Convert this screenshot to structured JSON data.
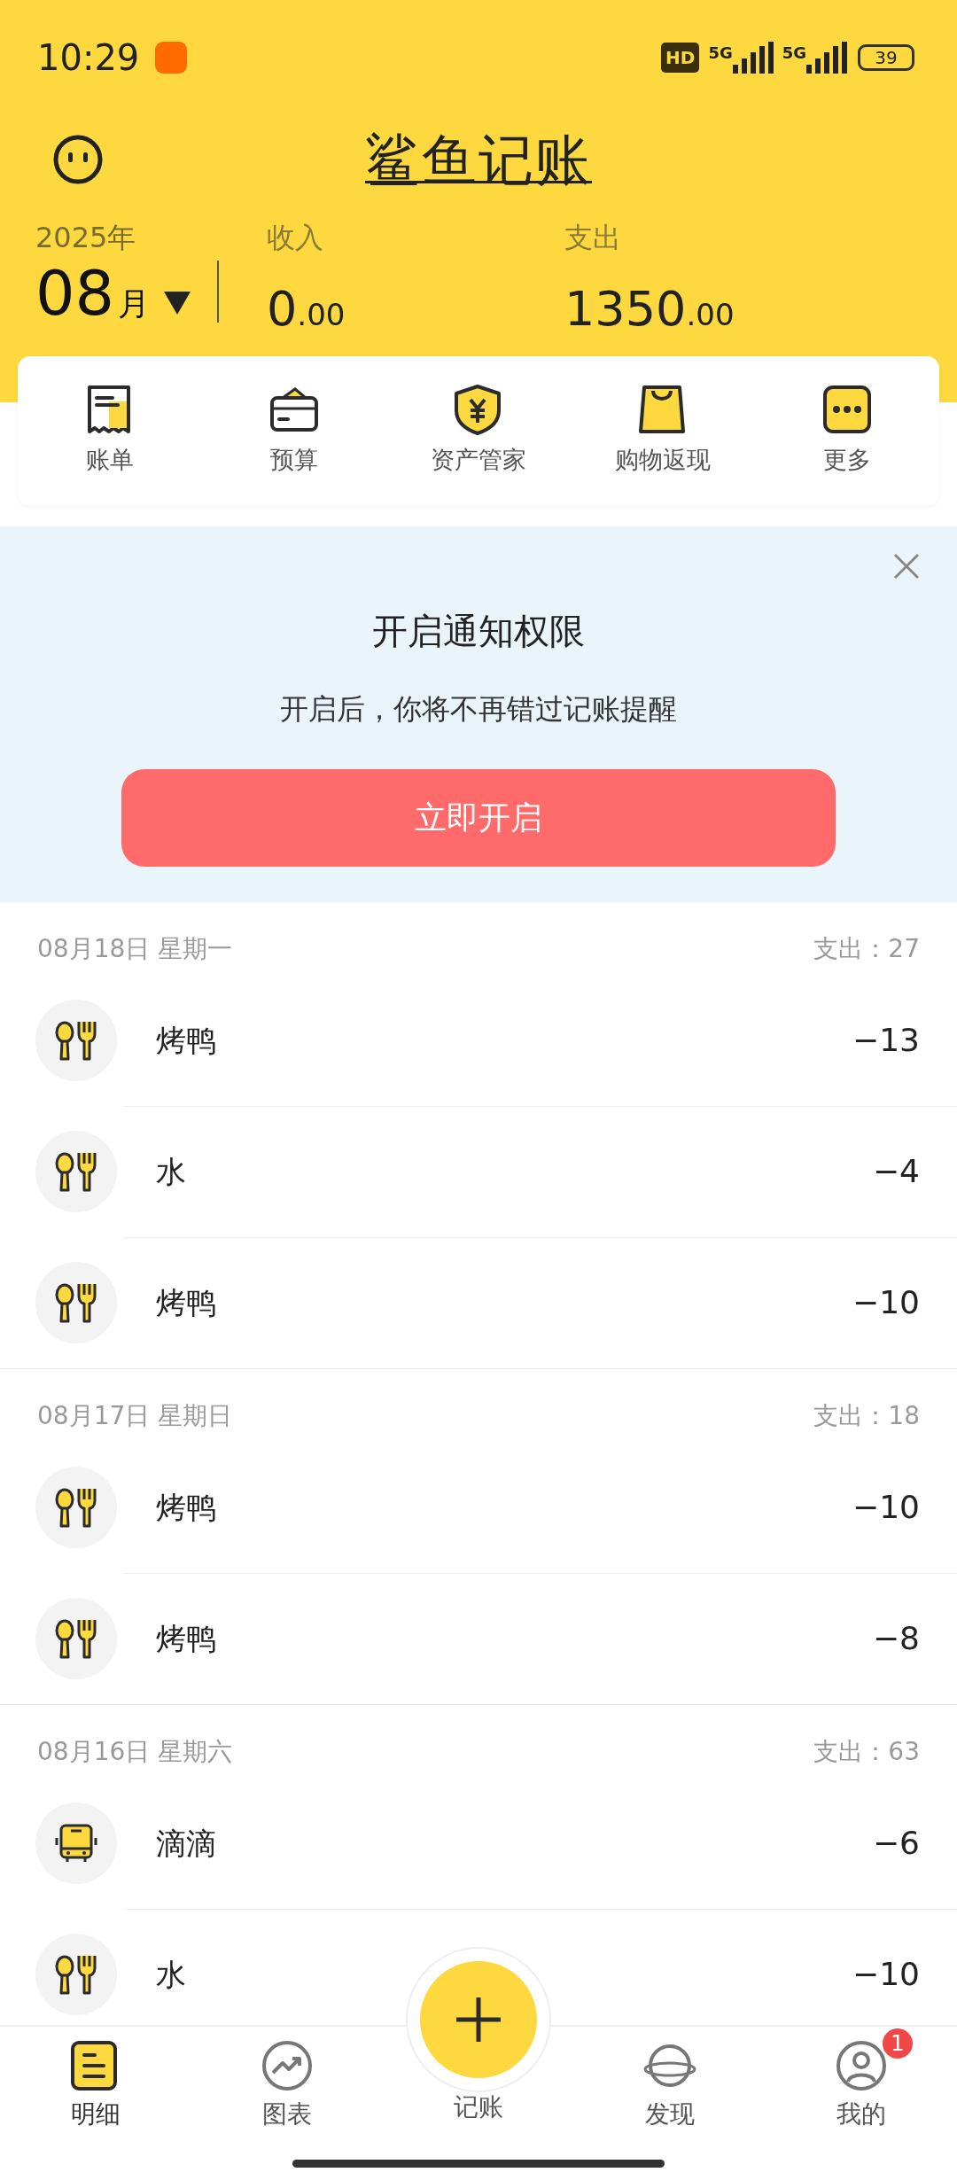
{
  "status_bar": {
    "time": "10:29",
    "hd": "HD",
    "networks": [
      "5G",
      "5G"
    ],
    "battery": "39"
  },
  "header": {
    "title": "鲨鱼记账",
    "year": "2025年",
    "month": "08",
    "month_unit": "月",
    "summary": [
      {
        "label": "收入",
        "integer": "0",
        "decimal": ".00"
      },
      {
        "label": "支出",
        "integer": "1350",
        "decimal": ".00"
      }
    ]
  },
  "tools": [
    {
      "kind": "bill",
      "label": "账单"
    },
    {
      "kind": "budget",
      "label": "预算"
    },
    {
      "kind": "assets",
      "label": "资产管家"
    },
    {
      "kind": "shopping",
      "label": "购物返现"
    },
    {
      "kind": "more",
      "label": "更多"
    }
  ],
  "notice": {
    "title": "开启通知权限",
    "text": "开启后，你将不再错过记账提醒",
    "button": "立即开启"
  },
  "days": [
    {
      "date": "08月18日 星期一",
      "total_label": "支出：",
      "total": "27",
      "entries": [
        {
          "kind": "dining",
          "name": "烤鸭",
          "amount": "−13"
        },
        {
          "kind": "dining",
          "name": "水",
          "amount": "−4"
        },
        {
          "kind": "dining",
          "name": "烤鸭",
          "amount": "−10"
        }
      ]
    },
    {
      "date": "08月17日 星期日",
      "total_label": "支出：",
      "total": "18",
      "entries": [
        {
          "kind": "dining",
          "name": "烤鸭",
          "amount": "−10"
        },
        {
          "kind": "dining",
          "name": "烤鸭",
          "amount": "−8"
        }
      ]
    },
    {
      "date": "08月16日 星期六",
      "total_label": "支出：",
      "total": "63",
      "entries": [
        {
          "kind": "transport",
          "name": "滴滴",
          "amount": "−6"
        },
        {
          "kind": "dining",
          "name": "水",
          "amount": "−10"
        }
      ]
    }
  ],
  "nav": [
    {
      "kind": "details",
      "label": "明细",
      "selected": true
    },
    {
      "kind": "chart",
      "label": "图表",
      "selected": false
    },
    {
      "kind": "add",
      "label": "记账",
      "selected": false
    },
    {
      "kind": "discover",
      "label": "发现",
      "selected": false
    },
    {
      "kind": "profile",
      "label": "我的",
      "selected": false,
      "badge": "1"
    }
  ]
}
